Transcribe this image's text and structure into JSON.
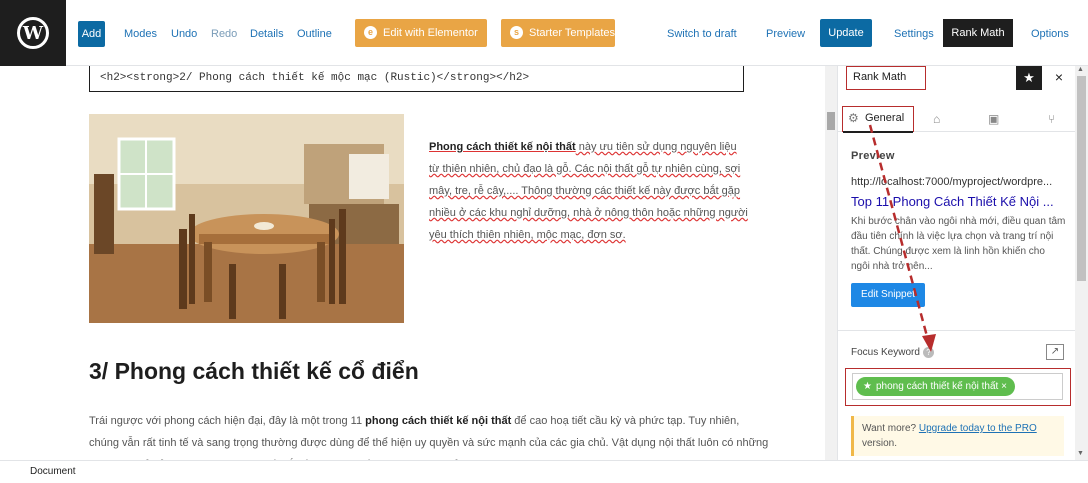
{
  "toolbar": {
    "add": "Add",
    "modes": "Modes",
    "undo": "Undo",
    "redo": "Redo",
    "details": "Details",
    "outline": "Outline",
    "edit_elementor": "Edit with Elementor",
    "starter_templates": "Starter Templates",
    "switch_draft": "Switch to draft",
    "preview": "Preview",
    "update": "Update",
    "settings": "Settings",
    "rank_math": "Rank Math",
    "options": "Options"
  },
  "editor": {
    "code_line": "<h2><strong>2/ Phong cách thiết kế mộc mạc (Rustic)</strong></h2>",
    "para_bold": "Phong cách thiết kế nội thất",
    "para_rest": " này ưu tiên sử dụng nguyên liệu từ thiên nhiên, chủ đạo là gỗ. Các nội thất gỗ tự nhiên cùng, sợi mây, tre, rễ cây,.... Thông thường các thiết kế này được bắt gặp nhiều ở các khu nghỉ dưỡng, nhà ở nông thôn hoặc những người yêu thích thiên nhiên, mộc mạc, đơn sơ.",
    "heading": "3/ Phong cách thiết kế cổ điển",
    "body_pre": "Trái ngược với phong cách hiện đại, đây là một trong 11 ",
    "body_bold": "phong cách thiết kế nội thất",
    "body_post": " để cao hoạ tiết cầu kỳ và phức tạp. Tuy nhiên, chúng vẫn rất tinh tế và sang trọng thường được dùng để thể hiện uy quyền và sức mạnh của các gia chủ. Vật dụng nội thất luôn có những đường nét tỉ mỉ với các vật liệu nội thất đắt tiền gợi nhớ về các cung điện của thời Vua Chúa"
  },
  "sidebar": {
    "title": "Rank Math",
    "tab_general": "General",
    "preview_label": "Preview",
    "url": "http://localhost:7000/myproject/wordpre...",
    "serp_title": "Top 11 Phong Cách Thiết Kế Nội ...",
    "serp_desc": "Khi bước chân vào ngôi nhà mới, điều quan tâm đầu tiên chính là việc lựa chọn và trang trí nội thất. Chúng được xem là linh hồn khiến cho ngôi nhà trở nên...",
    "edit_snippet": "Edit Snippet",
    "focus_keyword_label": "Focus Keyword",
    "keyword": "phong cách thiết kế nội thất",
    "upgrade_pre": "Want more? ",
    "upgrade_link": "Upgrade today to the PRO",
    "upgrade_post": " version."
  },
  "footer": {
    "breadcrumb": "Document"
  },
  "colors": {
    "accent_blue": "#0c6aa3",
    "elementor_orange": "#e9a545",
    "annotation_red": "#b72d2d",
    "keyword_green": "#5fbd4e"
  }
}
